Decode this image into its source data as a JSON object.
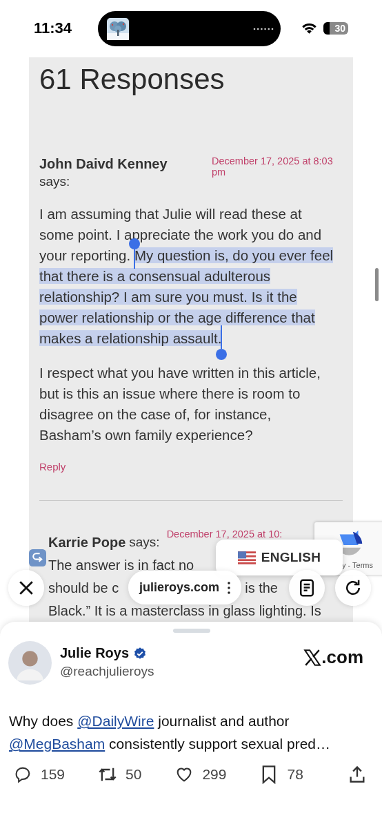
{
  "status_bar": {
    "time": "11:34",
    "battery": "30"
  },
  "article": {
    "heading": "61 Responses",
    "comments": [
      {
        "kind": "full",
        "author": "John Daivd Kenney",
        "says": "says:",
        "date": "December 17, 2025 at 8:03 pm",
        "reply_icon": false,
        "paragraphs": [
          {
            "segments": [
              {
                "text": "I am assuming that Julie will read these at some point. I appreciate the work you do and your reporting. ",
                "selected": false
              },
              {
                "text": "My question is, do you ever feel that there is a consensual adulterous relationship? I am sure you must. Is it the power relationship or the age difference that makes a relationship assault.",
                "selected": true
              }
            ]
          },
          {
            "segments": [
              {
                "text": "I respect what you have written in this article, but is this an issue where there is room to disagree on the case of, for instance, Basham’s own family experience?",
                "selected": false
              }
            ]
          }
        ],
        "reply_link": "Reply"
      },
      {
        "kind": "partial",
        "author": "Karrie Pope",
        "says": "says:",
        "date": "December 17, 2025 at 10:",
        "reply_icon": true,
        "lines": [
          [
            "The answer is in fact no"
          ],
          [
            "should be c",
            "is the"
          ],
          [
            "Black.” It is a masterclass in glass lighting. Is"
          ]
        ]
      }
    ]
  },
  "recaptcha": {
    "text": "y - Terms"
  },
  "translate_popup": {
    "label": "ENGLISH"
  },
  "browser_toolbar": {
    "url": "julieroys.com"
  },
  "tweet_sheet": {
    "name": "Julie Roys",
    "verified": true,
    "handle": "@reachjulieroys",
    "source": ".com",
    "text": [
      {
        "kind": "text",
        "text": "Why does "
      },
      {
        "kind": "mention",
        "text": "@DailyWire"
      },
      {
        "kind": "text",
        "text": " journalist and author "
      },
      {
        "kind": "mention",
        "text": "@MegBasham"
      },
      {
        "kind": "text",
        "text": " consistently support sexual pred…"
      }
    ],
    "actions": [
      {
        "kind": "reply",
        "count": "159"
      },
      {
        "kind": "repost",
        "count": "50"
      },
      {
        "kind": "like",
        "count": "299"
      },
      {
        "kind": "bookmark",
        "count": "78"
      },
      {
        "kind": "share"
      }
    ]
  }
}
